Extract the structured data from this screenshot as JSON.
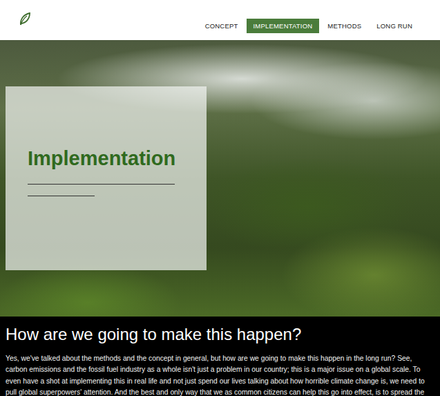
{
  "nav": {
    "items": [
      {
        "label": "CONCEPT",
        "selected": false
      },
      {
        "label": "IMPLEMENTATION",
        "selected": true
      },
      {
        "label": "METHODS",
        "selected": false
      },
      {
        "label": "LONG RUN",
        "selected": false
      }
    ]
  },
  "hero": {
    "title": "Implementation"
  },
  "section": {
    "heading": "How are we going to make this happen?",
    "body": "Yes, we've talked about the methods and the concept in general, but how are we going to make this happen in the long run? See, carbon emissions and the fossil fuel industry as a whole isn't just a problem in our country; this is a major issue on a global scale. To even have a shot at implementing this in real life and not just spend our lives talking about how horrible climate change is, we need to pull global superpowers' attention. And the best and only way that we as common citizens can help this go into effect, is to spread the"
  }
}
